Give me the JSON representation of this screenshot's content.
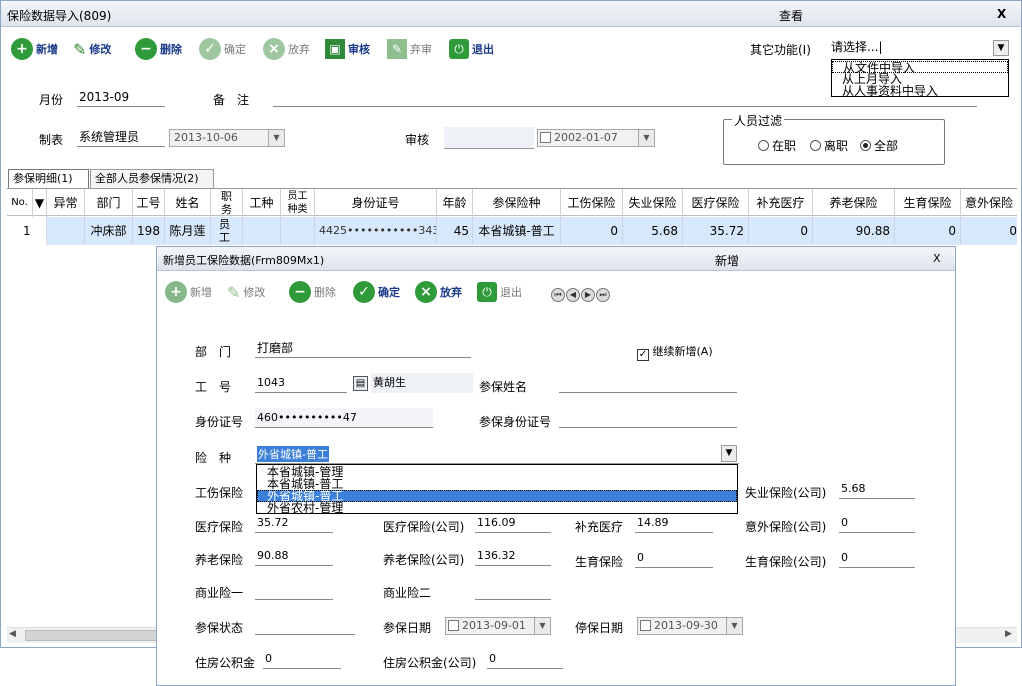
{
  "main_window": {
    "title": "保险数据导入(809)",
    "title_center": "查看",
    "close": "X",
    "toolbar": [
      {
        "name": "add",
        "label": "新增",
        "icon": "plus-icon",
        "enabled": true
      },
      {
        "name": "edit",
        "label": "修改",
        "icon": "pencil-icon",
        "enabled": true
      },
      {
        "name": "delete",
        "label": "删除",
        "icon": "minus-icon",
        "enabled": true
      },
      {
        "name": "confirm",
        "label": "确定",
        "icon": "check-icon",
        "enabled": false
      },
      {
        "name": "discard",
        "label": "放弃",
        "icon": "x-circle-icon",
        "enabled": false
      },
      {
        "name": "review",
        "label": "审核",
        "icon": "review-icon",
        "enabled": true
      },
      {
        "name": "unreview",
        "label": "弃审",
        "icon": "unreview-icon",
        "enabled": false
      },
      {
        "name": "exit",
        "label": "退出",
        "icon": "exit-icon",
        "enabled": true
      }
    ],
    "other_func_label": "其它功能(I)",
    "other_func_value": "请选择...|",
    "other_func_options": [
      "从文件中导入",
      "从上月导入",
      "从人事资料中导入"
    ],
    "form": {
      "month_label": "月份",
      "month_value": "2013-09",
      "remark_label": "备　注",
      "remark_value": "",
      "creator_label": "制表",
      "creator_value": "系统管理员",
      "creator_date": "2013-10-06",
      "reviewer_label": "审核",
      "reviewer_value": "",
      "review_date": "2002-01-07"
    },
    "person_filter": {
      "title": "人员过滤",
      "options": [
        "在职",
        "离职",
        "全部"
      ],
      "selected": "全部"
    },
    "tabs": [
      "参保明细(1)",
      "全部人员参保情况(2)"
    ],
    "table": {
      "headers": [
        "No.",
        "异常",
        "部门",
        "工号",
        "姓名",
        "职务",
        "工种",
        "员工种类",
        "身份证号",
        "年龄",
        "参保险种",
        "工伤保险",
        "失业保险",
        "医疗保险",
        "补充医疗",
        "养老保险",
        "生育保险",
        "意外保险"
      ],
      "rows": [
        [
          "1",
          "",
          "冲床部",
          "198",
          "陈月莲",
          "员工",
          "",
          "",
          "4425•••••••••••343",
          "45",
          "本省城镇-普工",
          "0",
          "5.68",
          "35.72",
          "0",
          "90.88",
          "0",
          "0"
        ]
      ]
    }
  },
  "dialog": {
    "title": "新增员工保险数据(Frm809Mx1)",
    "title_center": "新增",
    "close": "X",
    "toolbar": [
      {
        "name": "add",
        "label": "新增",
        "icon": "plus-icon",
        "enabled": false
      },
      {
        "name": "edit",
        "label": "修改",
        "icon": "pencil-icon",
        "enabled": false
      },
      {
        "name": "delete",
        "label": "删除",
        "icon": "minus-icon",
        "enabled": false
      },
      {
        "name": "confirm",
        "label": "确定",
        "icon": "check-icon",
        "enabled": true
      },
      {
        "name": "discard",
        "label": "放弃",
        "icon": "x-circle-icon",
        "enabled": true
      },
      {
        "name": "exit",
        "label": "退出",
        "icon": "exit-icon",
        "enabled": false
      }
    ],
    "fields": {
      "dept_label": "部　门",
      "dept_value": "打磨部",
      "continue_label": "继续新增(A)",
      "continue_checked": true,
      "empno_label": "工　号",
      "empno_value": "1043",
      "empno_name": "黄胡生",
      "insured_name_label": "参保姓名",
      "insured_name_value": "",
      "idno_label": "身份证号",
      "idno_value": "460••••••••••47",
      "insured_id_label": "参保身份证号",
      "insured_id_value": "",
      "type_label": "险　种",
      "type_value": "外省城镇-普工",
      "type_options": [
        "本省城镇-管理",
        "本省城镇-普工",
        "外省城镇-普工",
        "外省农村-管理"
      ],
      "injury_label": "工伤保险",
      "unemp_co_label": "失业保险(公司)",
      "unemp_co_value": "5.68",
      "med_label": "医疗保险",
      "med_value": "35.72",
      "med_co_label": "医疗保险(公司)",
      "med_co_value": "116.09",
      "supp_med_label": "补充医疗",
      "supp_med_value": "14.89",
      "accident_co_label": "意外保险(公司)",
      "accident_co_value": "0",
      "pension_label": "养老保险",
      "pension_value": "90.88",
      "pension_co_label": "养老保险(公司)",
      "pension_co_value": "136.32",
      "maternity_label": "生育保险",
      "maternity_value": "0",
      "maternity_co_label": "生育保险(公司)",
      "maternity_co_value": "0",
      "biz1_label": "商业险一",
      "biz1_value": "",
      "biz2_label": "商业险二",
      "biz2_value": "",
      "status_label": "参保状态",
      "status_value": "",
      "ins_date_label": "参保日期",
      "ins_date_value": "2013-09-01",
      "stop_date_label": "停保日期",
      "stop_date_value": "2013-09-30",
      "fund_label": "住房公积金",
      "fund_value": "0",
      "fund_co_label": "住房公积金(公司)",
      "fund_co_value": "0"
    }
  }
}
